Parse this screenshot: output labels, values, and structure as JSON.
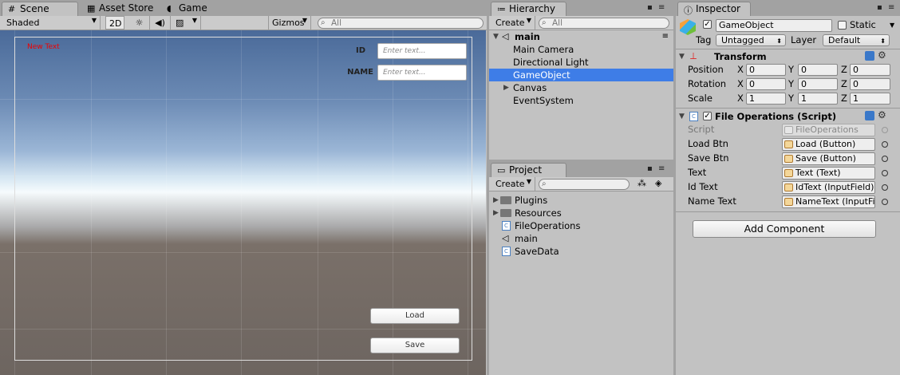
{
  "scene_panel": {
    "tabs": [
      {
        "label": "Scene",
        "icon": "grid-icon"
      },
      {
        "label": "Asset Store",
        "icon": "store-icon"
      },
      {
        "label": "Game",
        "icon": "pacman-icon"
      }
    ],
    "shading_mode": "Shaded",
    "toggle_2d": "2D",
    "gizmos_label": "Gizmos",
    "search_placeholder": "All",
    "canvas": {
      "new_text": "New Text",
      "id_label": "ID",
      "id_placeholder": "Enter text...",
      "name_label": "NAME",
      "name_placeholder": "Enter text...",
      "load_label": "Load",
      "save_label": "Save"
    }
  },
  "hierarchy": {
    "tab_label": "Hierarchy",
    "create_label": "Create",
    "search_placeholder": "All",
    "scene_name": "main",
    "items": [
      {
        "label": "Main Camera",
        "selected": false,
        "expandable": false
      },
      {
        "label": "Directional Light",
        "selected": false,
        "expandable": false
      },
      {
        "label": "GameObject",
        "selected": true,
        "expandable": false
      },
      {
        "label": "Canvas",
        "selected": false,
        "expandable": true
      },
      {
        "label": "EventSystem",
        "selected": false,
        "expandable": false
      }
    ]
  },
  "project": {
    "tab_label": "Project",
    "create_label": "Create",
    "items": [
      {
        "label": "Plugins",
        "icon": "folder-icon"
      },
      {
        "label": "Resources",
        "icon": "folder-icon"
      },
      {
        "label": "FileOperations",
        "icon": "csharp-script-icon"
      },
      {
        "label": "main",
        "icon": "unity-scene-icon"
      },
      {
        "label": "SaveData",
        "icon": "csharp-script-icon"
      }
    ]
  },
  "inspector": {
    "tab_label": "Inspector",
    "object_name": "GameObject",
    "static_label": "Static",
    "tag_label": "Tag",
    "tag_value": "Untagged",
    "layer_label": "Layer",
    "layer_value": "Default",
    "transform": {
      "title": "Transform",
      "rows": [
        {
          "label": "Position",
          "x": "0",
          "y": "0",
          "z": "0"
        },
        {
          "label": "Rotation",
          "x": "0",
          "y": "0",
          "z": "0"
        },
        {
          "label": "Scale",
          "x": "1",
          "y": "1",
          "z": "1"
        }
      ],
      "axis_x": "X",
      "axis_y": "Y",
      "axis_z": "Z"
    },
    "script_component": {
      "title": "File Operations (Script)",
      "fields": [
        {
          "label": "Script",
          "value": "FileOperations",
          "disabled": true
        },
        {
          "label": "Load Btn",
          "value": "Load (Button)",
          "disabled": false
        },
        {
          "label": "Save Btn",
          "value": "Save (Button)",
          "disabled": false
        },
        {
          "label": "Text",
          "value": "Text (Text)",
          "disabled": false
        },
        {
          "label": "Id Text",
          "value": "IdText (InputField)",
          "disabled": false
        },
        {
          "label": "Name Text",
          "value": "NameText (InputField)",
          "disabled": false
        }
      ]
    },
    "add_component_label": "Add Component"
  }
}
